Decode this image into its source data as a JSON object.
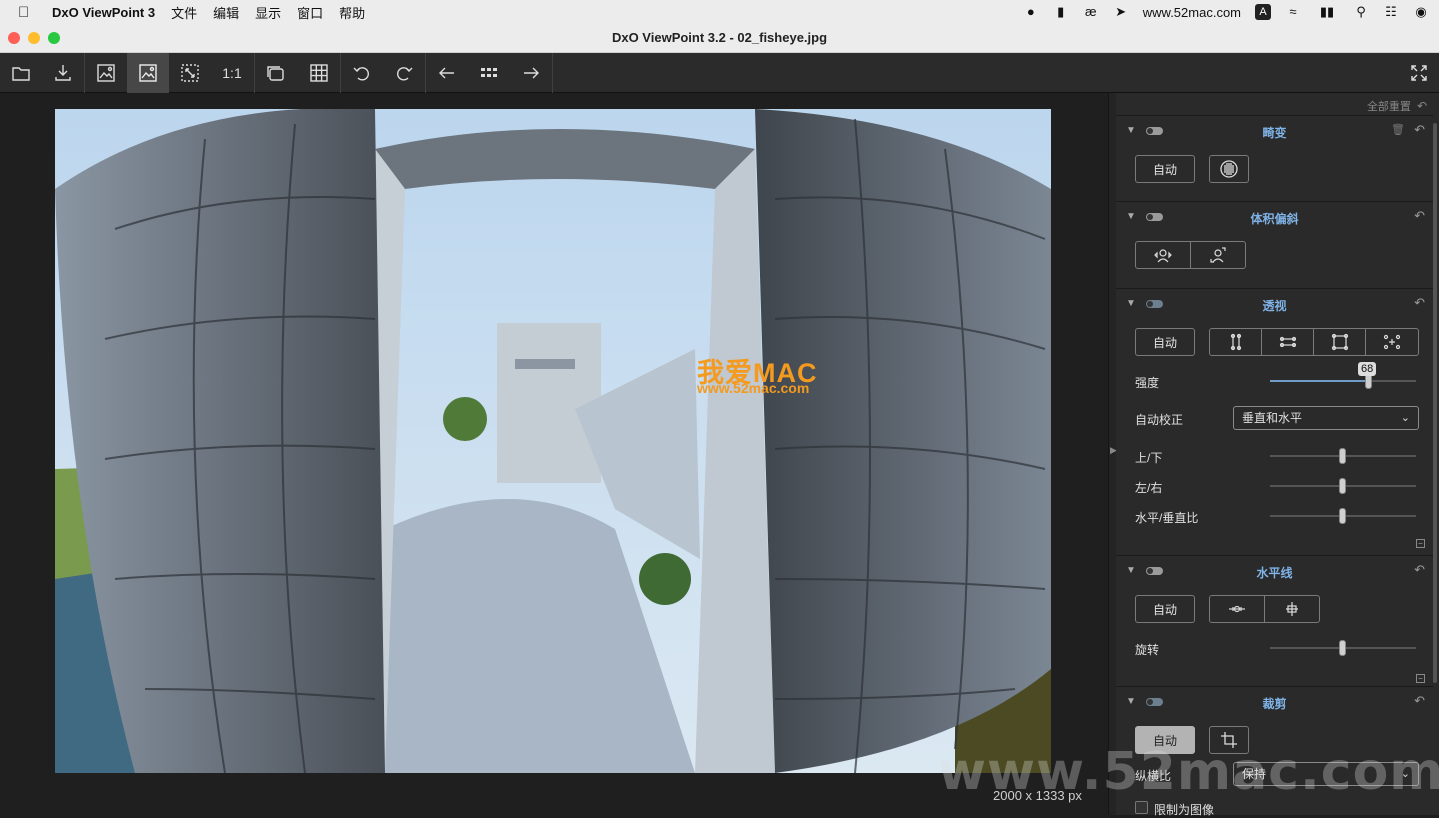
{
  "menubar": {
    "apple": "",
    "app_name": "DxO ViewPoint 3",
    "items": [
      "文件",
      "编辑",
      "显示",
      "窗口",
      "帮助"
    ],
    "site": "www.52mac.com",
    "input_indicator": "A"
  },
  "window": {
    "title": "DxO ViewPoint 3.2 - 02_fisheye.jpg"
  },
  "toolbar": {
    "actual_size_label": "1:1"
  },
  "viewer": {
    "image_dims": "2000 x 1333 px",
    "overlay_logo_main": "我爱MAC",
    "overlay_logo_sub": "www.52mac.com"
  },
  "panel": {
    "reset_all": "全部重置",
    "distortion": {
      "title": "畸变",
      "auto": "自动"
    },
    "volume": {
      "title": "体积偏斜"
    },
    "perspective": {
      "title": "透视",
      "auto": "自动",
      "intensity_label": "强度",
      "intensity_value": "68",
      "intensity_fraction": 0.68,
      "auto_correct_label": "自动校正",
      "auto_correct_value": "垂直和水平",
      "updown_label": "上/下",
      "leftright_label": "左/右",
      "ratio_label": "水平/垂直比"
    },
    "horizon": {
      "title": "水平线",
      "auto": "自动",
      "rotate_label": "旋转"
    },
    "crop": {
      "title": "裁剪",
      "auto": "自动",
      "aspect_label": "纵横比",
      "aspect_value": "保持",
      "limit_label": "限制为图像"
    }
  },
  "watermark": "www.52mac.com",
  "colors": {
    "accent": "#7fb2e6",
    "panel_bg": "#2a2a2a",
    "toolbar_bg": "#2b2b2b",
    "logo_orange": "#f39a1f",
    "logo_blue": "#2f8fe0"
  }
}
